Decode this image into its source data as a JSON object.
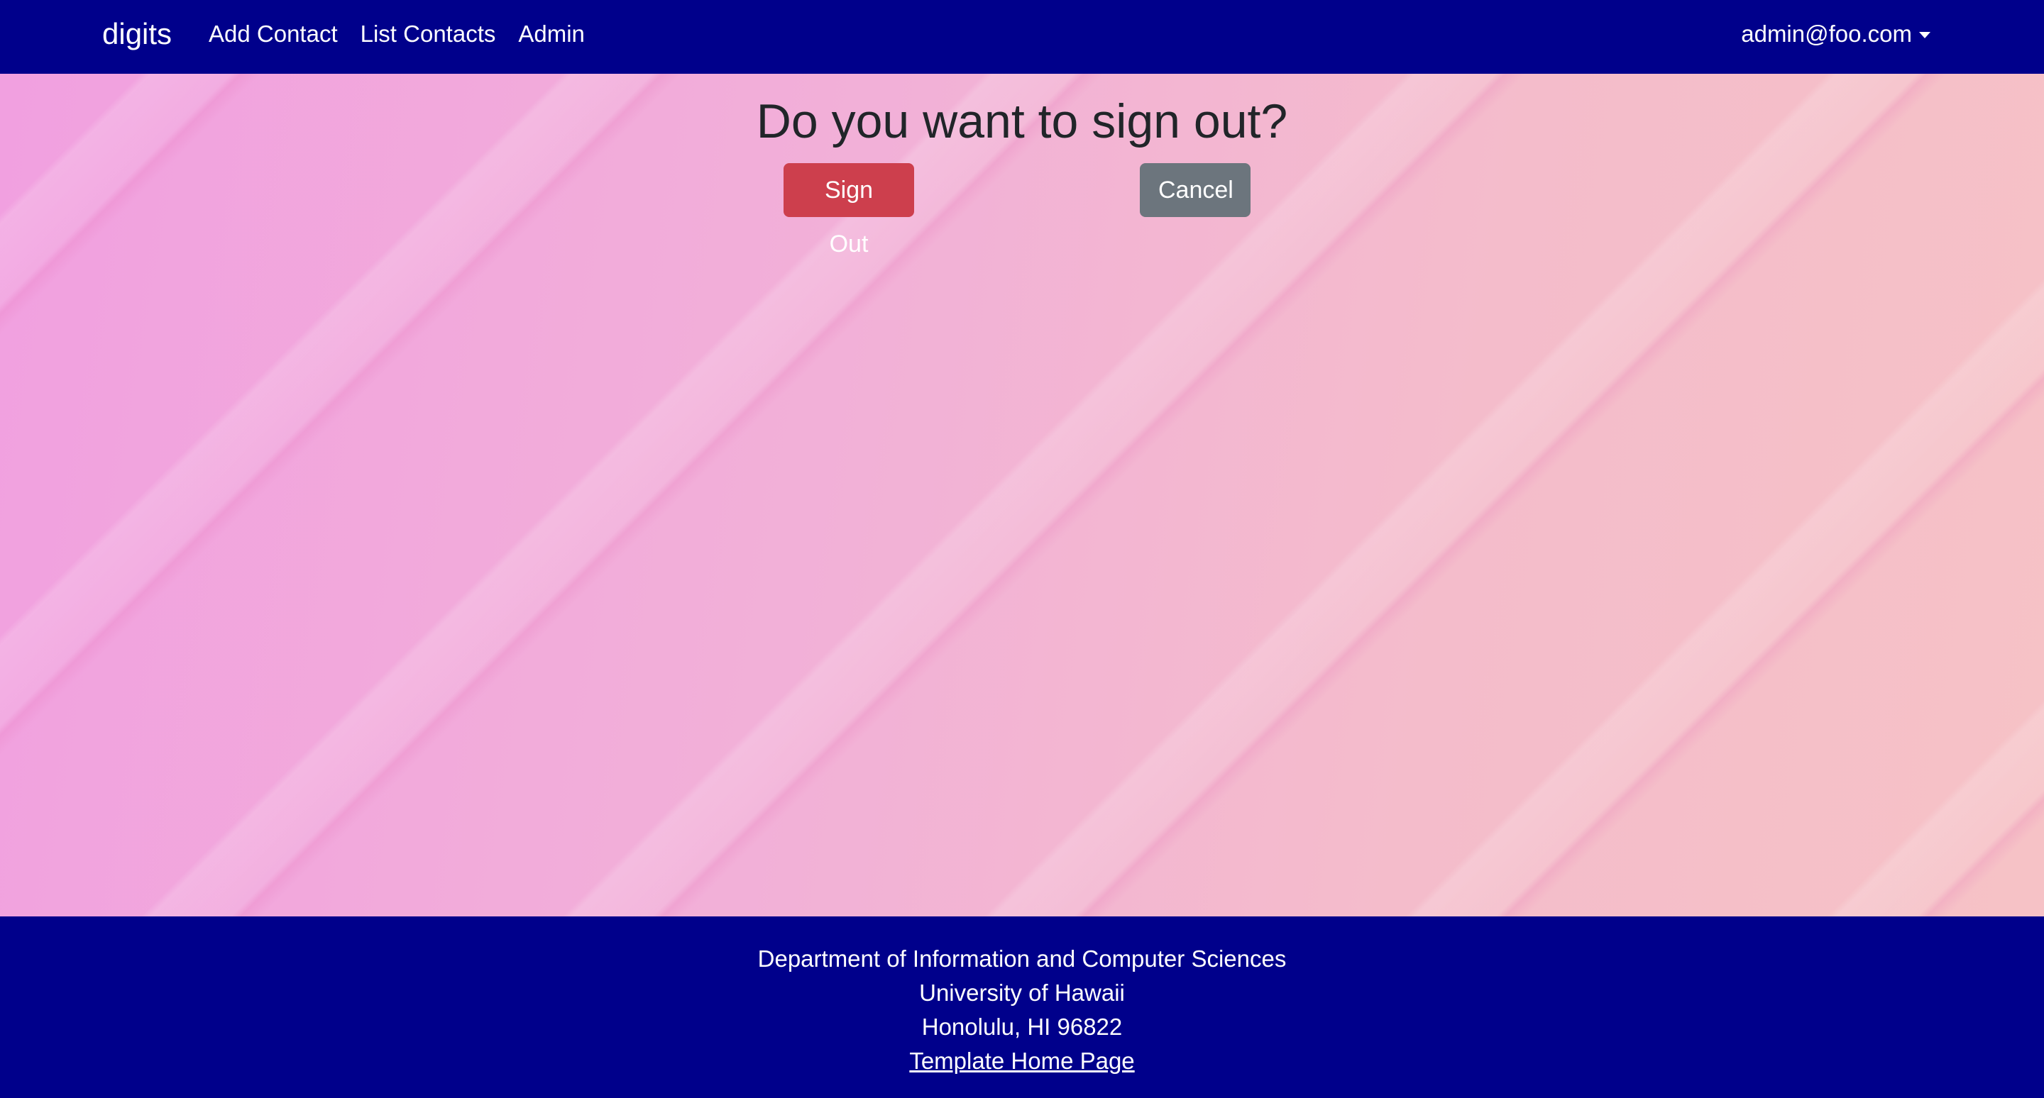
{
  "navbar": {
    "brand": "digits",
    "links": [
      "Add Contact",
      "List Contacts",
      "Admin"
    ],
    "user": "admin@foo.com",
    "background": "#00008b"
  },
  "main": {
    "title": "Do you want to sign out?",
    "signout_label": "Sign Out",
    "cancel_label": "Cancel"
  },
  "footer": {
    "lines": [
      "Department of Information and Computer Sciences",
      "University of Hawaii",
      "Honolulu, HI 96822"
    ],
    "link_label": "Template Home Page"
  },
  "colors": {
    "navbar": "#00008b",
    "signout_button": "#cd3f4d",
    "cancel_button": "#6c757d",
    "title_text": "#212529"
  },
  "icons": {
    "user_menu": "caret-down-icon"
  }
}
